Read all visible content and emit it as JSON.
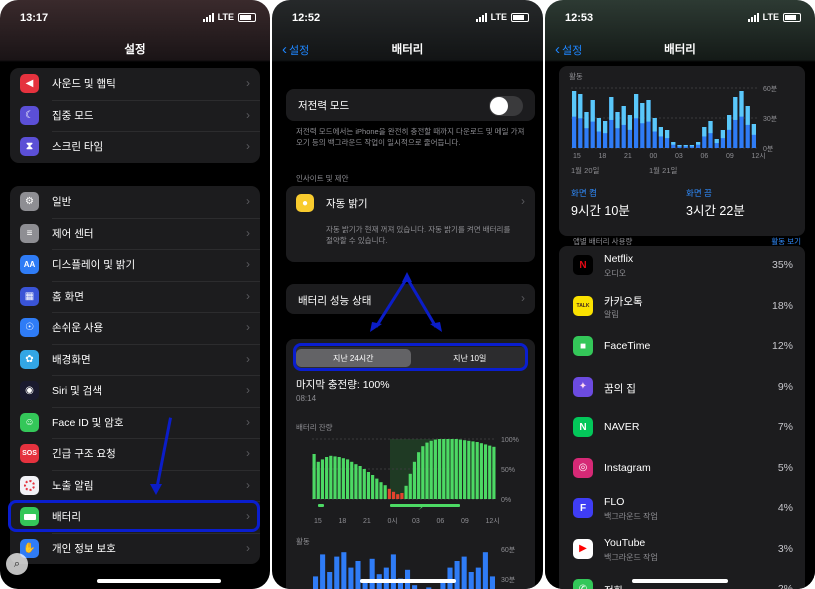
{
  "screen1": {
    "time": "13:17",
    "carrier": "LTE",
    "title": "설정",
    "group1": [
      {
        "label": "사운드 및 햅틱",
        "icon": "speaker-icon",
        "color": "#e5323e"
      },
      {
        "label": "집중 모드",
        "icon": "moon-icon",
        "color": "#5b4fd6"
      },
      {
        "label": "스크린 타임",
        "icon": "hourglass-icon",
        "color": "#5b4fd6"
      }
    ],
    "group2": [
      {
        "label": "일반",
        "icon": "gear-icon",
        "color": "#8e8e93"
      },
      {
        "label": "제어 센터",
        "icon": "toggles-icon",
        "color": "#8e8e93"
      },
      {
        "label": "디스플레이 및 밝기",
        "icon": "aa-icon",
        "color": "#2f7cf6"
      },
      {
        "label": "홈 화면",
        "icon": "grid-icon",
        "color": "#3a54d6"
      },
      {
        "label": "손쉬운 사용",
        "icon": "accessibility-icon",
        "color": "#2f7cf6"
      },
      {
        "label": "배경화면",
        "icon": "flower-icon",
        "color": "#33a6e5"
      },
      {
        "label": "Siri 및 검색",
        "icon": "siri-icon",
        "color": "#1a1a2e"
      },
      {
        "label": "Face ID 및 암호",
        "icon": "faceid-icon",
        "color": "#34c759"
      },
      {
        "label": "긴급 구조 요청",
        "icon": "sos-icon",
        "color": "#e5323e"
      },
      {
        "label": "노출 알림",
        "icon": "exposure-icon",
        "color": "#f2f2f7"
      },
      {
        "label": "배터리",
        "icon": "battery-icon",
        "color": "#34c759"
      },
      {
        "label": "개인 정보 보호",
        "icon": "hand-icon",
        "color": "#2f7cf6"
      }
    ],
    "sos_text": "SOS",
    "aa_text": "AA",
    "chevron": "›"
  },
  "screen2": {
    "time": "12:52",
    "carrier": "LTE",
    "back": "설정",
    "title": "배터리",
    "low_power_label": "저전력 모드",
    "low_power_on": false,
    "low_power_desc": "저전력 모드에서는 iPhone을 완전히 충전할 때까지 다운로드 및 메일 가져오기 등의 백그라운드 작업이 일시적으로 줄어듭니다.",
    "insights_header": "인사이트 및 제안",
    "auto_brightness_label": "자동 밝기",
    "auto_brightness_desc": "자동 밝기가 현재 꺼져 있습니다. 자동 밝기를 켜면 배터리를 절약할 수 있습니다.",
    "health_label": "배터리 성능 상태",
    "seg_24h": "지난 24시간",
    "seg_10d": "지난 10일",
    "last_charge": "마지막 충전량: 100%",
    "last_charge_time": "08:14",
    "battery_level_label": "배터리 잔량",
    "y_ticks": [
      "100%",
      "50%",
      "0%"
    ],
    "x_ticks": [
      "15",
      "18",
      "21",
      "0시",
      "03",
      "06",
      "09",
      "12시"
    ],
    "activity_label": "활동",
    "activity_ticks": [
      "60분",
      "30분"
    ],
    "battery_levels": [
      0.75,
      0.62,
      0.66,
      0.7,
      0.72,
      0.71,
      0.7,
      0.68,
      0.66,
      0.62,
      0.58,
      0.55,
      0.5,
      0.45,
      0.4,
      0.34,
      0.28,
      0.23,
      0.17,
      0.12,
      0.08,
      0.1,
      0.22,
      0.42,
      0.62,
      0.78,
      0.88,
      0.94,
      0.97,
      0.99,
      1.0,
      1.0,
      1.0,
      1.0,
      1.0,
      0.99,
      0.98,
      0.97,
      0.96,
      0.95,
      0.93,
      0.91,
      0.89,
      0.87
    ],
    "activity_levels": [
      0.4,
      0.9,
      0.5,
      0.85,
      0.95,
      0.6,
      0.75,
      0.3,
      0.8,
      0.45,
      0.6,
      0.9,
      0.35,
      0.55,
      0.2,
      0.1,
      0.15,
      0.05,
      0.3,
      0.6,
      0.75,
      0.85,
      0.5,
      0.6,
      0.95,
      0.4
    ]
  },
  "screen3": {
    "time": "12:53",
    "carrier": "LTE",
    "back": "설정",
    "title": "배터리",
    "activity_label": "활동",
    "y_ticks": [
      "60분",
      "30분",
      "0분"
    ],
    "x_ticks": [
      "15",
      "18",
      "21",
      "00",
      "03",
      "06",
      "09",
      "12시"
    ],
    "date_left": "1월 20일",
    "date_right": "1월 21일",
    "screen_on_label": "화면 켬",
    "screen_on_value": "9시간 10분",
    "screen_off_label": "화면 끔",
    "screen_off_value": "3시간 22분",
    "usage_header": "앱별 배터리 사용량",
    "show_activity": "활동 보기",
    "activity_bars": [
      0.95,
      0.9,
      0.6,
      0.8,
      0.5,
      0.45,
      0.85,
      0.6,
      0.7,
      0.55,
      0.9,
      0.75,
      0.8,
      0.5,
      0.35,
      0.3,
      0.1,
      0.05,
      0.05,
      0.05,
      0.1,
      0.35,
      0.45,
      0.15,
      0.3,
      0.55,
      0.85,
      0.95,
      0.7,
      0.4
    ],
    "apps": [
      {
        "name": "Netflix",
        "sub": "오디오",
        "pct": "35%",
        "icon": "netflix-icon",
        "color": "#000000",
        "glyph": "N",
        "glyph_color": "#e50914"
      },
      {
        "name": "카카오톡",
        "sub": "알림",
        "pct": "18%",
        "icon": "kakaotalk-icon",
        "color": "#fae100",
        "glyph": "TALK",
        "glyph_color": "#3c1e1e"
      },
      {
        "name": "FaceTime",
        "sub": "",
        "pct": "12%",
        "icon": "facetime-icon",
        "color": "#34c759",
        "glyph": "■",
        "glyph_color": "#ffffff"
      },
      {
        "name": "꿈의 집",
        "sub": "",
        "pct": "9%",
        "icon": "dream-home-icon",
        "color": "#6c4be0",
        "glyph": "✦",
        "glyph_color": "#ffd6f0"
      },
      {
        "name": "NAVER",
        "sub": "",
        "pct": "7%",
        "icon": "naver-icon",
        "color": "#03c75a",
        "glyph": "N",
        "glyph_color": "#ffffff"
      },
      {
        "name": "Instagram",
        "sub": "",
        "pct": "5%",
        "icon": "instagram-icon",
        "color": "#d62976",
        "glyph": "◎",
        "glyph_color": "#ffffff"
      },
      {
        "name": "FLO",
        "sub": "백그라운드 작업",
        "pct": "4%",
        "icon": "flo-icon",
        "color": "#3f3df5",
        "glyph": "F",
        "glyph_color": "#ffffff"
      },
      {
        "name": "YouTube",
        "sub": "백그라운드 작업",
        "pct": "3%",
        "icon": "youtube-icon",
        "color": "#ffffff",
        "glyph": "▶",
        "glyph_color": "#ff0000"
      },
      {
        "name": "전화",
        "sub": "",
        "pct": "2%",
        "icon": "phone-icon",
        "color": "#34c759",
        "glyph": "✆",
        "glyph_color": "#ffffff"
      }
    ]
  }
}
